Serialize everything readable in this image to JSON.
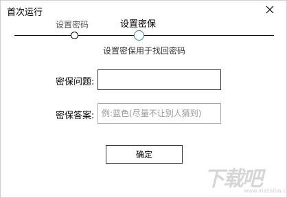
{
  "window": {
    "title": "首次运行",
    "close_icon": "close-icon"
  },
  "steps": {
    "items": [
      {
        "label": "设置密码",
        "state": "done"
      },
      {
        "label": "设置密保",
        "state": "current"
      }
    ],
    "hint": "设置密保用于找回密码",
    "accent": "#2b7fbf"
  },
  "form": {
    "question_label": "密保问题:",
    "question_value": "",
    "answer_label": "密保答案:",
    "answer_value": "",
    "answer_placeholder": "例:蓝色(尽量不让别人猜到)"
  },
  "confirm_label": "确定",
  "watermark": {
    "logo_text": "下载吧",
    "site": "www.xiazaiba.com"
  }
}
